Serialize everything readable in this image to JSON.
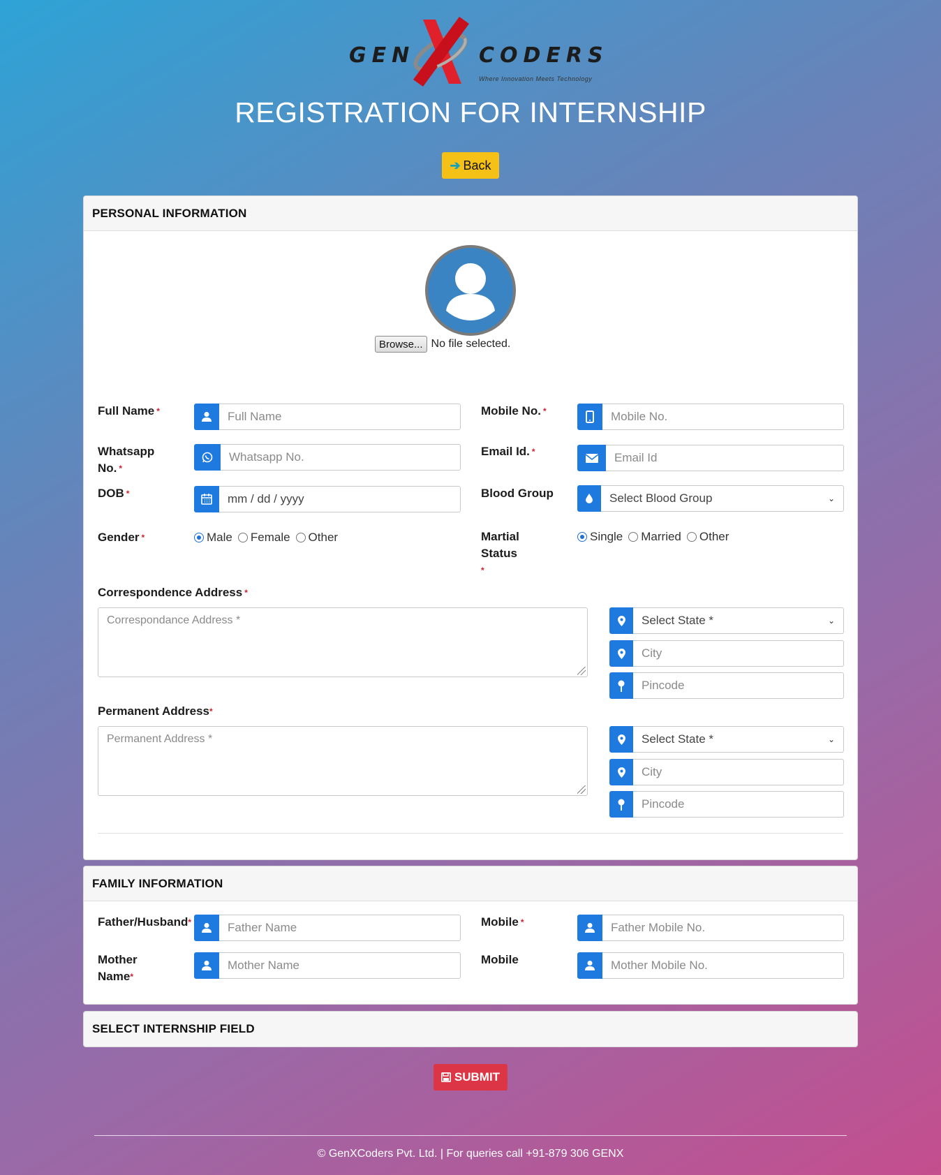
{
  "brand": {
    "logo_left": "GEN",
    "logo_right": "CODERS",
    "tagline": "Where Innovation Meets Technology"
  },
  "page_title": "REGISTRATION FOR INTERNSHIP",
  "back_label": "Back",
  "personal": {
    "heading": "PERSONAL INFORMATION",
    "browse_label": "Browse...",
    "file_status": "No file selected.",
    "full_name": {
      "label": "Full Name",
      "placeholder": "Full Name"
    },
    "mobile": {
      "label": "Mobile No.",
      "placeholder": "Mobile No."
    },
    "whatsapp": {
      "label": "Whatsapp No.",
      "placeholder": "Whatsapp No."
    },
    "email": {
      "label": "Email Id.",
      "placeholder": "Email Id"
    },
    "dob": {
      "label": "DOB",
      "value": "mm / dd / yyyy"
    },
    "blood_group": {
      "label": "Blood Group",
      "value": "Select Blood Group"
    },
    "gender": {
      "label": "Gender",
      "options": [
        "Male",
        "Female",
        "Other"
      ],
      "selected": "Male"
    },
    "marital": {
      "label": "Martial Status",
      "options": [
        "Single",
        "Married",
        "Other"
      ],
      "selected": "Single"
    },
    "correspondence": {
      "label": "Correspondence Address",
      "placeholder": "Correspondance Address *",
      "state": "Select State *",
      "city": "City",
      "pincode": "Pincode"
    },
    "permanent": {
      "label": "Permanent Address",
      "placeholder": "Permanent Address *",
      "state": "Select State *",
      "city": "City",
      "pincode": "Pincode"
    }
  },
  "family": {
    "heading": "FAMILY INFORMATION",
    "father": {
      "label": "Father/Husband",
      "placeholder": "Father Name"
    },
    "father_mobile": {
      "label": "Mobile",
      "placeholder": "Father Mobile No."
    },
    "mother": {
      "label": "Mother Name",
      "placeholder": "Mother Name"
    },
    "mother_mobile": {
      "label": "Mobile",
      "placeholder": "Mother Mobile No."
    }
  },
  "internship": {
    "heading": "SELECT INTERNSHIP FIELD"
  },
  "submit_label": "SUBMIT",
  "footer": "© GenXCoders Pvt. Ltd. | For queries call +91-879 306 GENX",
  "colors": {
    "accent": "#1f7ae0",
    "back_button": "#f5c116",
    "submit_button": "#dc3545"
  }
}
